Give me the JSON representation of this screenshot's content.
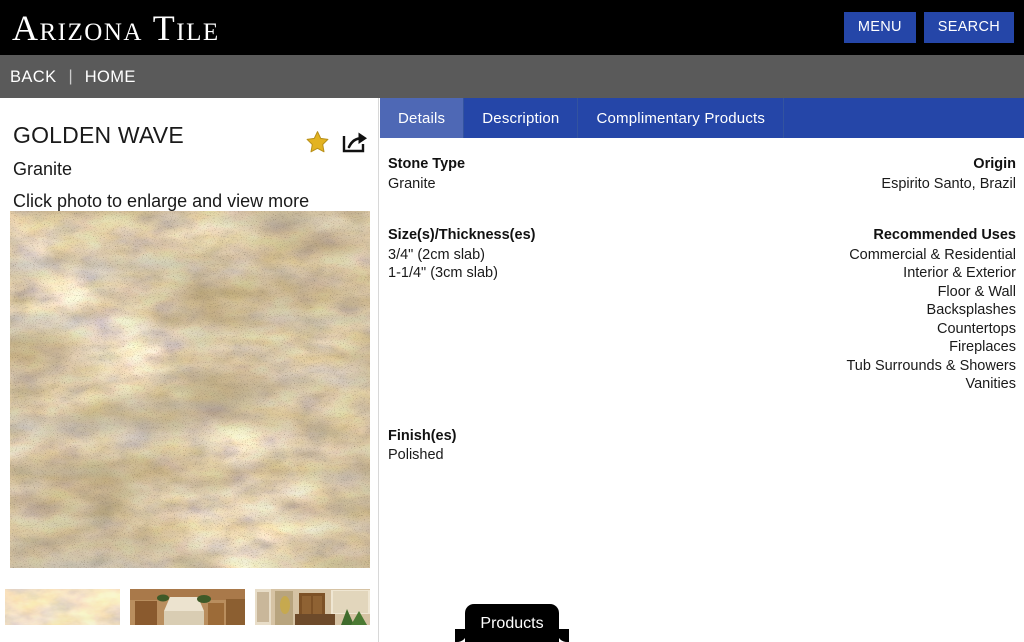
{
  "header": {
    "logo": "Arizona Tile",
    "menu_label": "MENU",
    "search_label": "SEARCH",
    "accent_blue": "#2546a8",
    "background": "#000000"
  },
  "navbar": {
    "back_label": "BACK",
    "separator": "|",
    "home_label": "HOME",
    "background": "#5a5a5a"
  },
  "product": {
    "title": "GOLDEN WAVE",
    "subtitle": "Granite",
    "hint": "Click photo to enlarge and view more",
    "favorite_icon": "star-icon",
    "share_icon": "share-icon",
    "favorite_color": "#e3b321",
    "main_image_alt": "Golden Wave granite slab swatch",
    "thumbnails": [
      {
        "alt": "Golden Wave granite slab close-up"
      },
      {
        "alt": "Kitchen with range hood and wood cabinetry"
      },
      {
        "alt": "Living room interior with wood shutters"
      }
    ]
  },
  "tabs": [
    {
      "label": "Details",
      "active": true
    },
    {
      "label": "Description",
      "active": false
    },
    {
      "label": "Complimentary Products",
      "active": false
    }
  ],
  "details": {
    "rows": [
      {
        "left_head": "Stone Type",
        "left_values": "Granite",
        "right_head": "Origin",
        "right_values": "Espirito Santo, Brazil"
      },
      {
        "left_head": "Size(s)/Thickness(es)",
        "left_values": "3/4\" (2cm slab)\n1-1/4\" (3cm slab)",
        "right_head": "Recommended Uses",
        "right_values": "Commercial & Residential\nInterior & Exterior\nFloor & Wall\nBacksplashes\nCountertops\nFireplaces\nTub Surrounds & Showers\nVanities"
      },
      {
        "left_head": "Finish(es)",
        "left_values": "Polished",
        "right_head": "",
        "right_values": ""
      }
    ]
  },
  "footer": {
    "products_label": "Products"
  }
}
